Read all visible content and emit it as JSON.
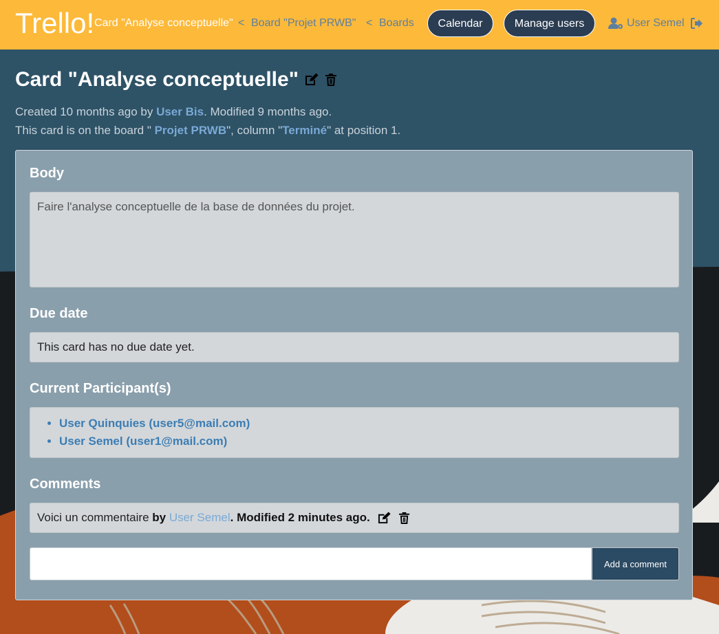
{
  "nav": {
    "brand": "Trello!",
    "crumb_current": "Card \"Analyse conceptuelle\"",
    "crumb_sep": "<",
    "crumb_board": "Board \"Projet PRWB\"",
    "crumb_boards": "Boards",
    "calendar": "Calendar",
    "manage_users": "Manage users",
    "user": "User Semel",
    "colors": {
      "nav_bg": "#fdb939",
      "pill_bg": "#2b3d52",
      "link": "#5d7fa0"
    }
  },
  "card": {
    "title": "Card \"Analyse conceptuelle\"",
    "meta_created_prefix": "Created 10 months ago by ",
    "meta_author": "User Bis",
    "meta_modified": ". Modified 9 months ago.",
    "meta_board_prefix": "This card is on the board \" ",
    "meta_board": "Projet PRWB",
    "meta_column_prefix": "\", column \"",
    "meta_column": "Terminé",
    "meta_position": "\" at position 1."
  },
  "body": {
    "heading": "Body",
    "text": "Faire l'analyse conceptuelle de la base de données du projet."
  },
  "due": {
    "heading": "Due date",
    "text": "This card has no due date yet."
  },
  "participants": {
    "heading": "Current Participant(s)",
    "items": [
      "User Quinquies (user5@mail.com)",
      "User Semel (user1@mail.com)"
    ]
  },
  "comments": {
    "heading": "Comments",
    "items": [
      {
        "text": "Voici un commentaire ",
        "by": "by ",
        "author": "User Semel",
        "modified": ". Modified 2 minutes ago."
      }
    ],
    "input_value": "",
    "add_label": "Add a comment"
  },
  "icons": [
    "edit-icon",
    "trash-icon",
    "user-gear-icon",
    "logout-icon"
  ]
}
